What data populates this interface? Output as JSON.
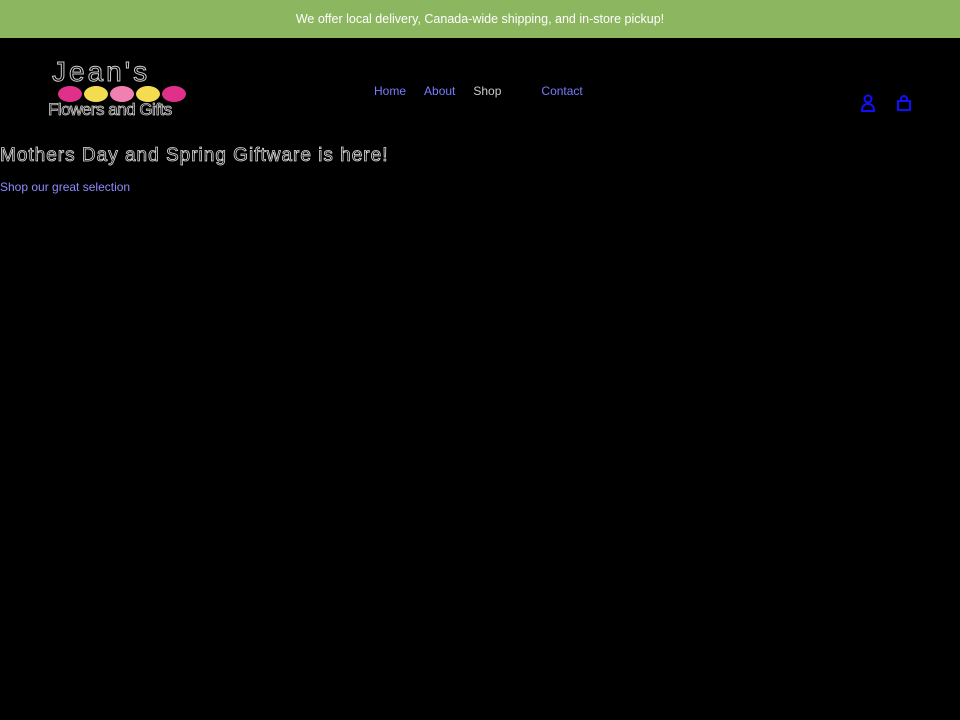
{
  "banner": {
    "text": "We offer local delivery, Canada-wide shipping, and in-store pickup!"
  },
  "logo": {
    "line1": "Jean's",
    "line2": "Flowers and Gifts"
  },
  "nav": {
    "items": [
      {
        "label": "Home"
      },
      {
        "label": "About"
      },
      {
        "label": "Shop"
      },
      {
        "label": "Contact"
      }
    ]
  },
  "icons": {
    "account": "account-icon",
    "cart": "cart-icon"
  },
  "hero": {
    "title": "Mothers Day and Spring Giftware is here!",
    "link": "Shop our great selection"
  },
  "colors": {
    "banner": "#8db660",
    "link": "#7b7bff",
    "icon": "#1010ff"
  }
}
